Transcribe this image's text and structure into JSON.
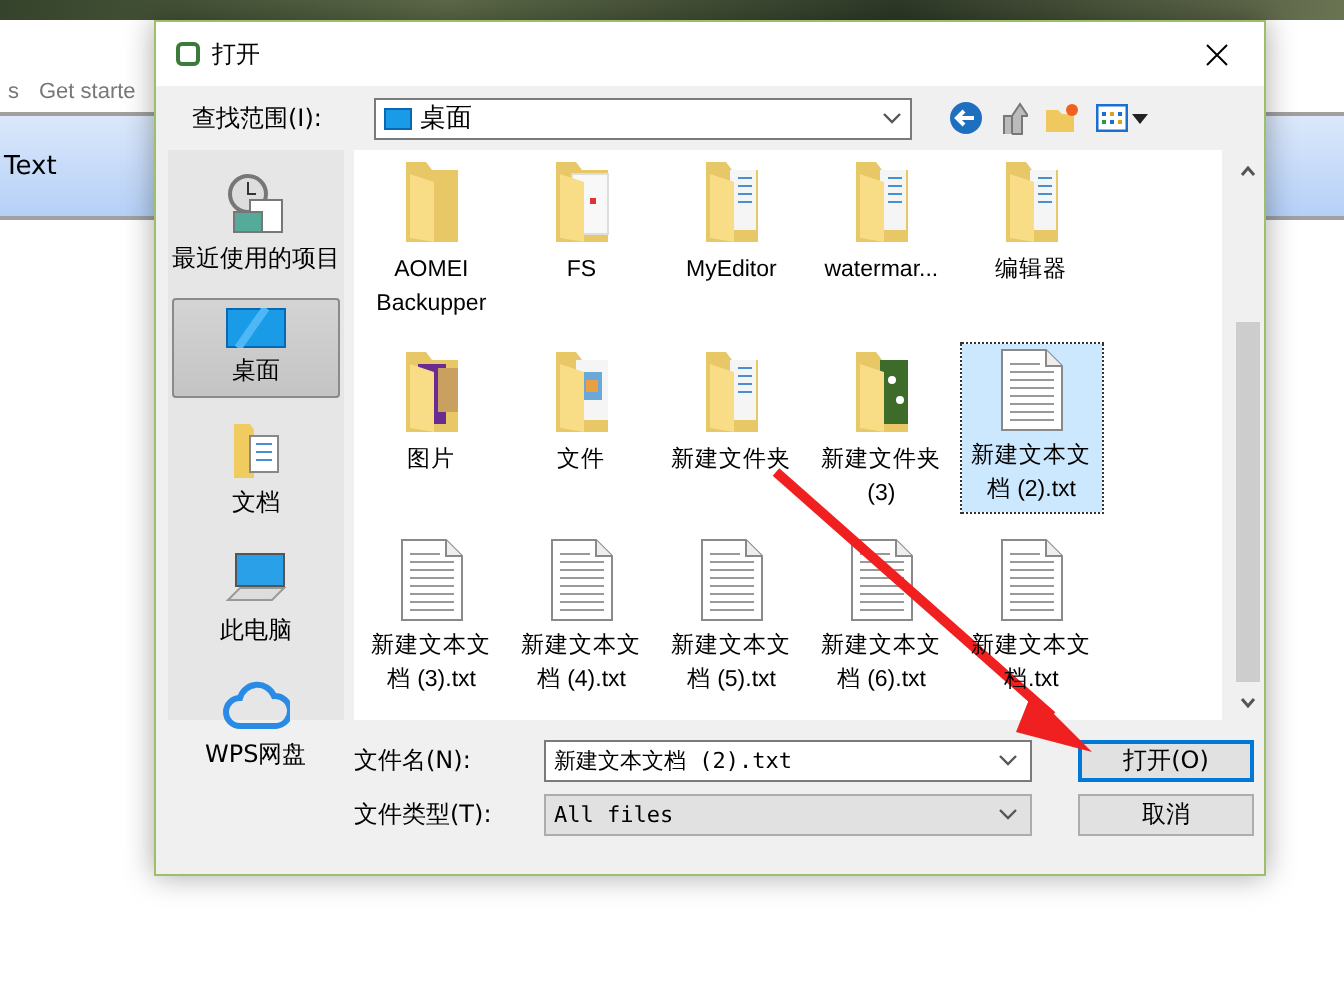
{
  "background_app": {
    "menu": [
      "s",
      "Get starte"
    ],
    "row_label": "Text"
  },
  "dialog": {
    "title": "打开",
    "look_in": {
      "label": "查找范围(I):",
      "value": "桌面"
    },
    "places": [
      {
        "label": "最近使用的项目",
        "kind": "recent",
        "selected": false
      },
      {
        "label": "桌面",
        "kind": "desktop",
        "selected": true
      },
      {
        "label": "文档",
        "kind": "documents",
        "selected": false
      },
      {
        "label": "此电脑",
        "kind": "computer",
        "selected": false
      },
      {
        "label": "WPS网盘",
        "kind": "cloud",
        "selected": false
      }
    ],
    "files": [
      {
        "name": "AOMEI Backupper",
        "kind": "folder",
        "selected": false
      },
      {
        "name": "FS",
        "kind": "folder-doc",
        "selected": false
      },
      {
        "name": "MyEditor",
        "kind": "folder-files",
        "selected": false
      },
      {
        "name": "watermar...",
        "kind": "folder-files",
        "selected": false
      },
      {
        "name": "编辑器",
        "kind": "folder-files",
        "selected": false
      },
      {
        "name": "图片",
        "kind": "folder-purple",
        "selected": false
      },
      {
        "name": "文件",
        "kind": "folder-photos",
        "selected": false
      },
      {
        "name": "新建文件夹",
        "kind": "folder-files",
        "selected": false
      },
      {
        "name": "新建文件夹 (3)",
        "kind": "folder-green",
        "selected": false
      },
      {
        "name": "新建文本文档 (2).txt",
        "kind": "text",
        "selected": true
      },
      {
        "name": "新建文本文档 (3).txt",
        "kind": "text",
        "selected": false
      },
      {
        "name": "新建文本文档 (4).txt",
        "kind": "text",
        "selected": false
      },
      {
        "name": "新建文本文档 (5).txt",
        "kind": "text",
        "selected": false
      },
      {
        "name": "新建文本文档 (6).txt",
        "kind": "text",
        "selected": false
      },
      {
        "name": "新建文本文档.txt",
        "kind": "text",
        "selected": false
      }
    ],
    "file_name": {
      "label": "文件名(N):",
      "value": "新建文本文档 (2).txt"
    },
    "file_type": {
      "label": "文件类型(T):",
      "value": "All files"
    },
    "buttons": [
      {
        "label": "打开(O)",
        "kind": "primary"
      },
      {
        "label": "取消",
        "kind": "cancel"
      }
    ]
  }
}
